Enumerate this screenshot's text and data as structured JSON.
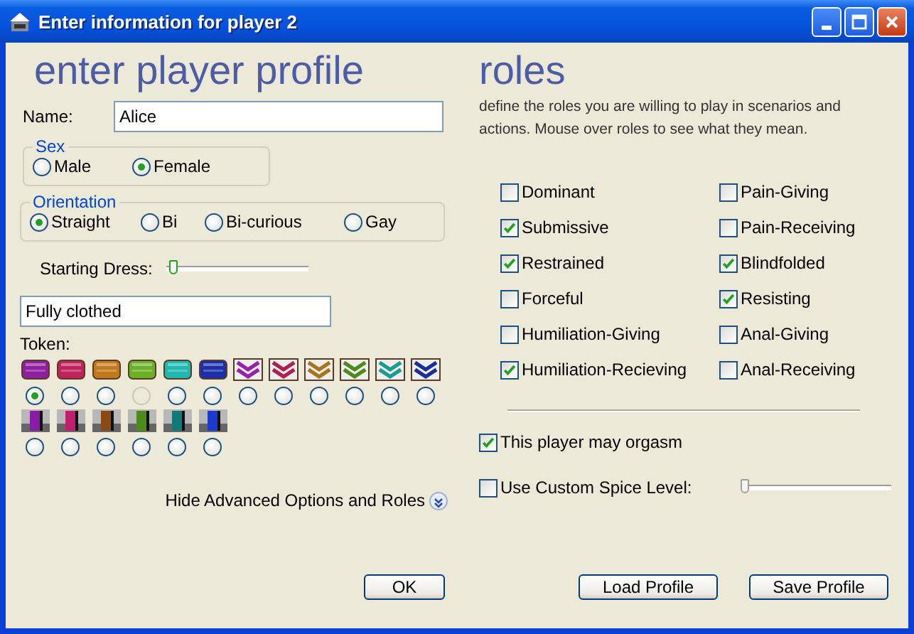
{
  "window": {
    "title": "Enter information for player 2"
  },
  "profile": {
    "heading": "enter player profile",
    "name_label": "Name:",
    "name_value": "Alice",
    "sex": {
      "legend": "Sex",
      "options": [
        {
          "label": "Male",
          "selected": false
        },
        {
          "label": "Female",
          "selected": true
        }
      ]
    },
    "orientation": {
      "legend": "Orientation",
      "options": [
        {
          "label": "Straight",
          "selected": true
        },
        {
          "label": "Bi",
          "selected": false
        },
        {
          "label": "Bi-curious",
          "selected": false
        },
        {
          "label": "Gay",
          "selected": false
        }
      ]
    },
    "starting_dress": {
      "label": "Starting Dress:",
      "level": 0.02,
      "value": "Fully clothed"
    },
    "token": {
      "label": "Token:",
      "rows": [
        [
          {
            "kind": "bar",
            "color": "#8e1fa0",
            "selected": true,
            "disabled": false
          },
          {
            "kind": "bar",
            "color": "#c0245e",
            "selected": false,
            "disabled": false
          },
          {
            "kind": "bar",
            "color": "#c07a1c",
            "selected": false,
            "disabled": false
          },
          {
            "kind": "bar",
            "color": "#6cb02a",
            "selected": false,
            "disabled": true
          },
          {
            "kind": "bar",
            "color": "#1fb8b0",
            "selected": false,
            "disabled": false
          },
          {
            "kind": "bar",
            "color": "#1c2fa8",
            "selected": false,
            "disabled": false
          },
          {
            "kind": "chevron",
            "color": "#9a1ea8",
            "selected": false,
            "disabled": false
          },
          {
            "kind": "chevron",
            "color": "#b0204e",
            "selected": false,
            "disabled": false
          },
          {
            "kind": "chevron",
            "color": "#a8741c",
            "selected": false,
            "disabled": false
          },
          {
            "kind": "chevron",
            "color": "#4e8a1c",
            "selected": false,
            "disabled": false
          },
          {
            "kind": "chevron",
            "color": "#1e9a94",
            "selected": false,
            "disabled": false
          },
          {
            "kind": "chevron",
            "color": "#1a2f9a",
            "selected": false,
            "disabled": false
          }
        ],
        [
          {
            "kind": "block",
            "color": "#8a1aa8",
            "selected": false,
            "disabled": false
          },
          {
            "kind": "block",
            "color": "#c01e6e",
            "selected": false,
            "disabled": false
          },
          {
            "kind": "block",
            "color": "#8a4a14",
            "selected": false,
            "disabled": false
          },
          {
            "kind": "block",
            "color": "#4e8a1c",
            "selected": false,
            "disabled": false
          },
          {
            "kind": "block",
            "color": "#127a74",
            "selected": false,
            "disabled": false
          },
          {
            "kind": "block",
            "color": "#1a3ad0",
            "selected": false,
            "disabled": false
          }
        ]
      ]
    },
    "hide_advanced": "Hide Advanced Options and Roles"
  },
  "roles": {
    "heading": "roles",
    "description": "define the roles you are willing to play in scenarios and actions. Mouse over roles to see what they mean.",
    "items": [
      {
        "label": "Dominant",
        "checked": false
      },
      {
        "label": "Pain-Giving",
        "checked": false
      },
      {
        "label": "Submissive",
        "checked": true
      },
      {
        "label": "Pain-Receiving",
        "checked": false
      },
      {
        "label": "Restrained",
        "checked": true
      },
      {
        "label": "Blindfolded",
        "checked": true
      },
      {
        "label": "Forceful",
        "checked": false
      },
      {
        "label": "Resisting",
        "checked": true
      },
      {
        "label": "Humiliation-Giving",
        "checked": false
      },
      {
        "label": "Anal-Giving",
        "checked": false
      },
      {
        "label": "Humiliation-Recieving",
        "checked": true
      },
      {
        "label": "Anal-Receiving",
        "checked": false
      }
    ],
    "may_orgasm": {
      "label": "This player may orgasm",
      "checked": true
    },
    "custom_spice": {
      "label": "Use Custom Spice Level:",
      "checked": false,
      "level": 0.0
    }
  },
  "buttons": [
    {
      "label": "OK"
    },
    {
      "label": "Load Profile"
    },
    {
      "label": "Save Profile"
    }
  ]
}
